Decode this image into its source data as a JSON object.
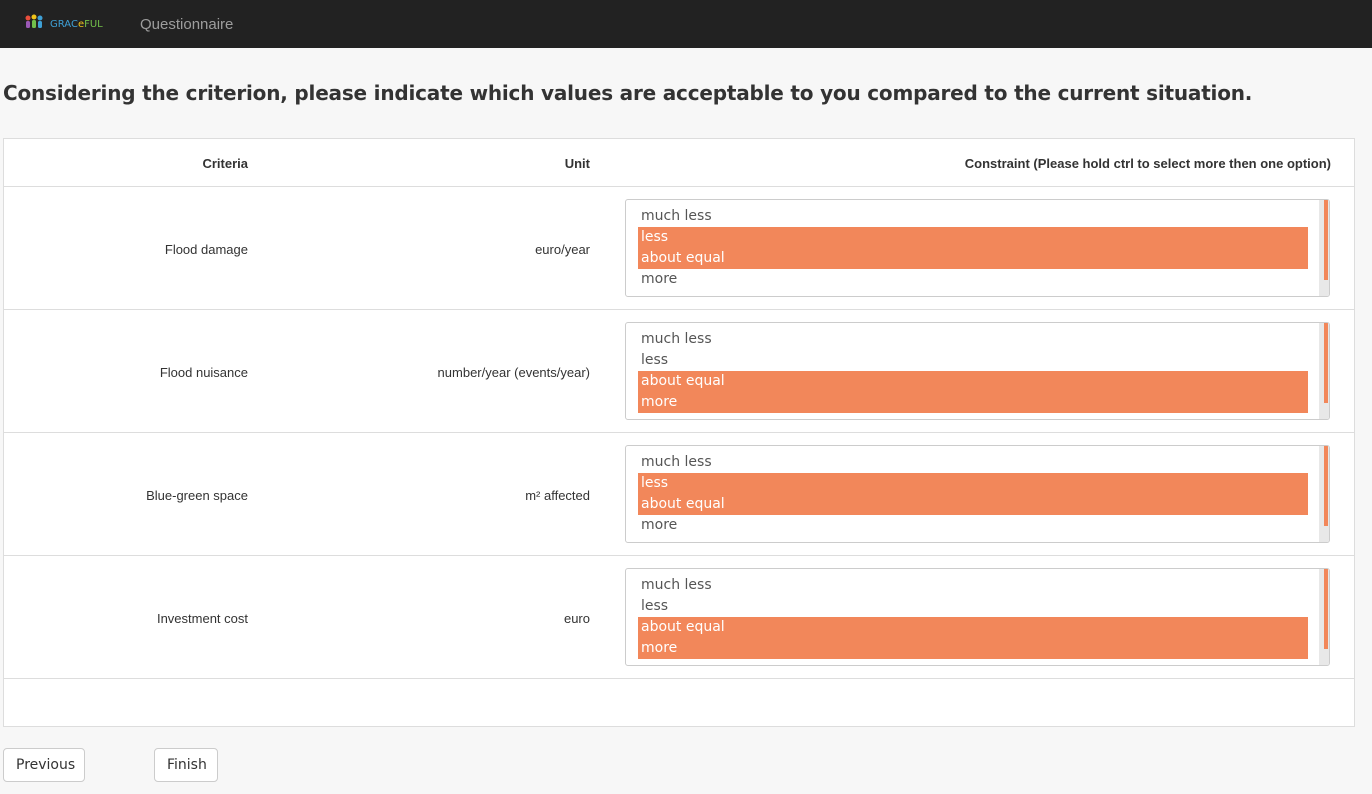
{
  "navbar": {
    "logo_text_a": "GRAC",
    "logo_text_b": "e",
    "logo_text_c": "FUL",
    "link": "Questionnaire"
  },
  "heading": "Considering the criterion, please indicate which values are acceptable to you compared to the current situation.",
  "table": {
    "headers": {
      "criteria": "Criteria",
      "unit": "Unit",
      "constraint": "Constraint (Please hold ctrl to select more then one option)"
    },
    "rows": [
      {
        "criteria": "Flood damage",
        "unit": "euro/year",
        "options": [
          "much less",
          "less",
          "about equal",
          "more"
        ],
        "selected": [
          false,
          true,
          true,
          false
        ]
      },
      {
        "criteria": "Flood nuisance",
        "unit": "number/year (events/year)",
        "options": [
          "much less",
          "less",
          "about equal",
          "more"
        ],
        "selected": [
          false,
          false,
          true,
          true
        ]
      },
      {
        "criteria": "Blue-green space",
        "unit": "m² affected",
        "options": [
          "much less",
          "less",
          "about equal",
          "more"
        ],
        "selected": [
          false,
          true,
          true,
          false
        ]
      },
      {
        "criteria": "Investment cost",
        "unit": "euro",
        "options": [
          "much less",
          "less",
          "about equal",
          "more"
        ],
        "selected": [
          false,
          false,
          true,
          true
        ]
      }
    ]
  },
  "buttons": {
    "previous": "Previous",
    "finish": "Finish"
  },
  "colors": {
    "navbar": "#222222",
    "selected": "#f2875a"
  }
}
